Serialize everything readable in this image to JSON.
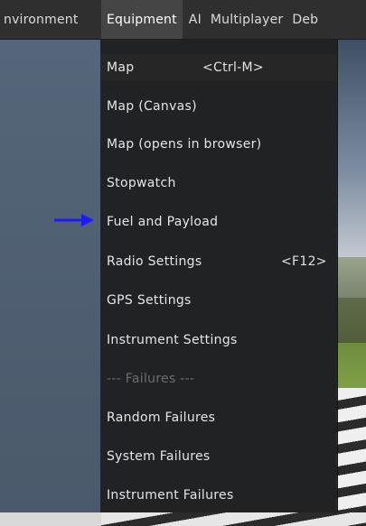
{
  "menubar": {
    "items": [
      {
        "label": "nvironment"
      },
      {
        "label": "Equipment"
      },
      {
        "label": "AI"
      },
      {
        "label": "Multiplayer"
      },
      {
        "label": "Deb"
      }
    ]
  },
  "dropdown": {
    "items": [
      {
        "label": "Map",
        "shortcut": "<Ctrl-M>"
      },
      {
        "label": "Map (Canvas)"
      },
      {
        "label": "Map (opens in browser)"
      },
      {
        "label": "Stopwatch"
      },
      {
        "label": "Fuel and Payload"
      },
      {
        "label": "Radio Settings",
        "shortcut": "<F12>"
      },
      {
        "label": "GPS Settings"
      },
      {
        "label": "Instrument Settings"
      },
      {
        "label": "--- Failures ---"
      },
      {
        "label": "Random Failures"
      },
      {
        "label": "System Failures"
      },
      {
        "label": "Instrument Failures"
      }
    ]
  },
  "annotation": {
    "arrow_icon": "arrow-right-icon",
    "arrow_color": "#1a1aff"
  }
}
